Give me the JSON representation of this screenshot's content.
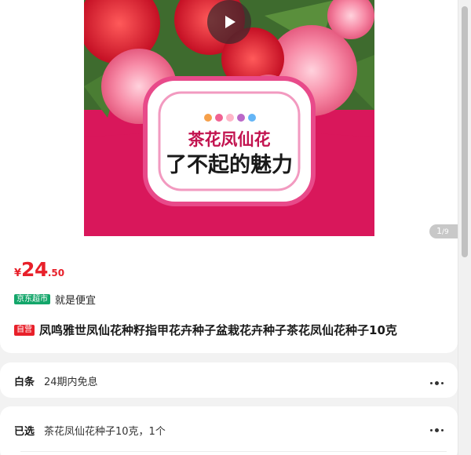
{
  "product": {
    "hero_title_line1": "茶花凤仙花",
    "hero_title_line2": "了不起的魅力",
    "pager_current": "1",
    "pager_total": "/9",
    "price_currency": "¥",
    "price_integer": "24",
    "price_decimal": ".50",
    "jd_tag": "京东超市",
    "slogan": "就是便宜",
    "self_tag": "自营",
    "title": "凤鸣雅世凤仙花种籽指甲花卉种子盆栽花卉种子茶花凤仙花种子10克"
  },
  "baitiao": {
    "label": "白条",
    "value": "24期内免息"
  },
  "selected": {
    "label": "已选",
    "value": "茶花凤仙花种子10克，1个"
  },
  "colors": {
    "price_red": "#e8202a",
    "jd_green": "#13a66a",
    "hero_magenta": "#d9175b"
  },
  "icons": [
    "play-icon",
    "more-icon"
  ]
}
